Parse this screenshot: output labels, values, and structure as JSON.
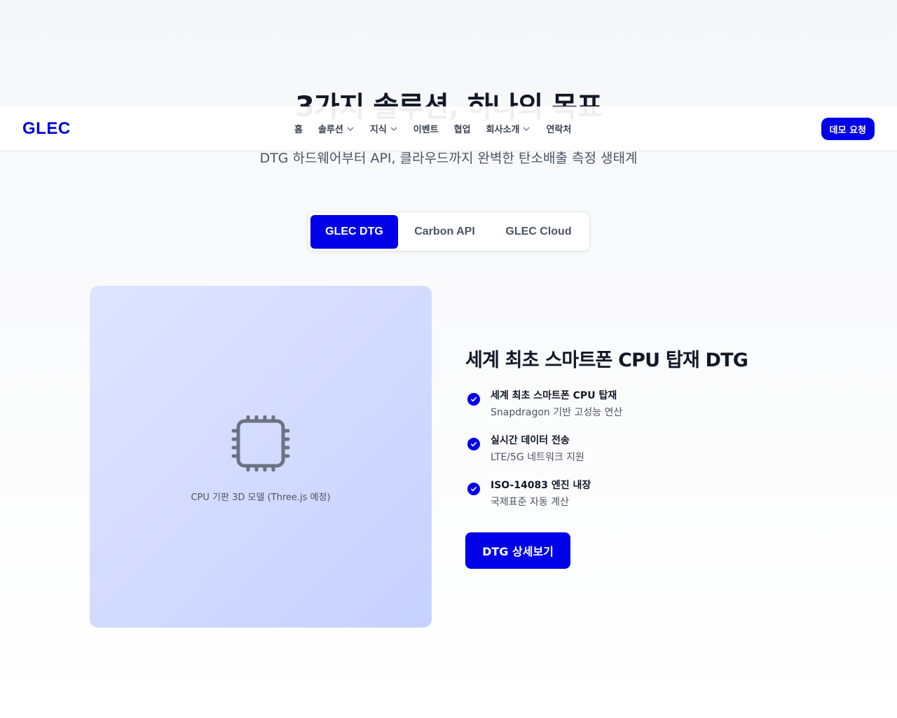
{
  "section": {
    "heading": "3가지 솔루션, 하나의 목표",
    "subtitle": "DTG 하드웨어부터 API, 클라우드까지 완벽한 탄소배출 측정 생태계"
  },
  "nav": {
    "logo": "GLEC",
    "items": [
      {
        "label": "홈",
        "has_dropdown": false
      },
      {
        "label": "솔루션",
        "has_dropdown": true
      },
      {
        "label": "지식",
        "has_dropdown": true
      },
      {
        "label": "이벤트",
        "has_dropdown": false
      },
      {
        "label": "협업",
        "has_dropdown": false
      },
      {
        "label": "회사소개",
        "has_dropdown": true
      },
      {
        "label": "연락처",
        "has_dropdown": false
      }
    ],
    "cta": "데모 요청"
  },
  "tabs": {
    "items": [
      "GLEC DTG",
      "Carbon API",
      "GLEC Cloud"
    ],
    "active": "GLEC DTG"
  },
  "visual": {
    "icon": "cpu-icon",
    "caption": "CPU 기판 3D 모델 (Three.js 예정)"
  },
  "detail": {
    "title": "세계 최초 스마트폰 CPU 탑재 DTG",
    "features": [
      {
        "title": "세계 최초 스마트폰 CPU 탑재",
        "desc": "Snapdragon 기반 고성능 연산"
      },
      {
        "title": "실시간 데이터 전송",
        "desc": "LTE/5G 네트워크 지원"
      },
      {
        "title": "ISO-14083 엔진 내장",
        "desc": "국제표준 자동 계산"
      }
    ],
    "cta": "DTG 상세보기"
  },
  "colors": {
    "accent": "#0000e8",
    "text": "#111827",
    "muted": "#4b5563",
    "card_gradient_start": "#dfe4ff",
    "card_gradient_end": "#c7d1ff"
  }
}
